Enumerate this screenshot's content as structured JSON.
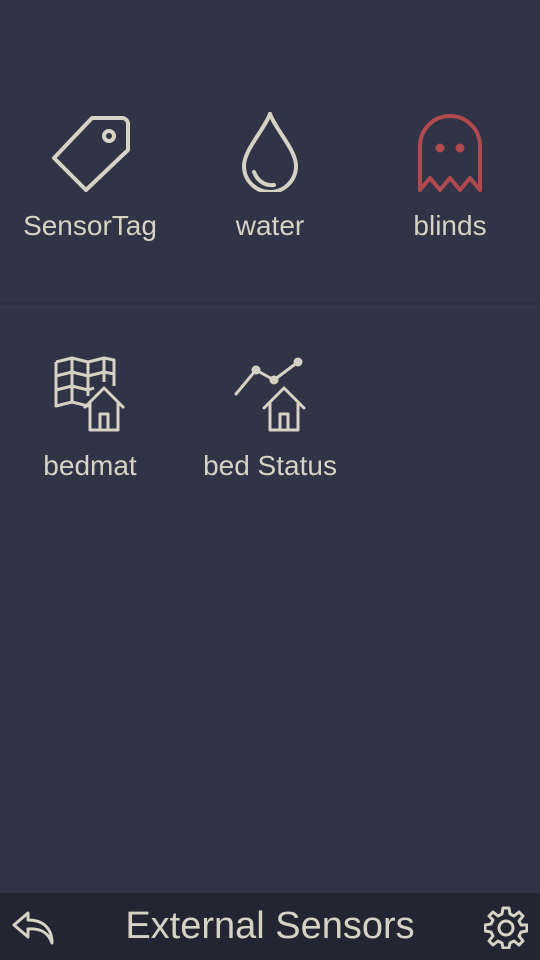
{
  "tiles_row1": [
    {
      "label": "SensorTag",
      "icon": "tag-icon"
    },
    {
      "label": "water",
      "icon": "water-drop-icon"
    },
    {
      "label": "blinds",
      "icon": "ghost-icon"
    }
  ],
  "tiles_row2": [
    {
      "label": "bedmat",
      "icon": "map-house-icon"
    },
    {
      "label": "bed Status",
      "icon": "chart-house-icon"
    }
  ],
  "bottom_bar": {
    "title": "External Sensors",
    "back_icon": "reply-arrow-icon",
    "settings_icon": "gear-icon"
  },
  "colors": {
    "background": "#313346",
    "bar": "#232532",
    "text": "#d6d2c4",
    "accent_red": "#b04a4e"
  }
}
